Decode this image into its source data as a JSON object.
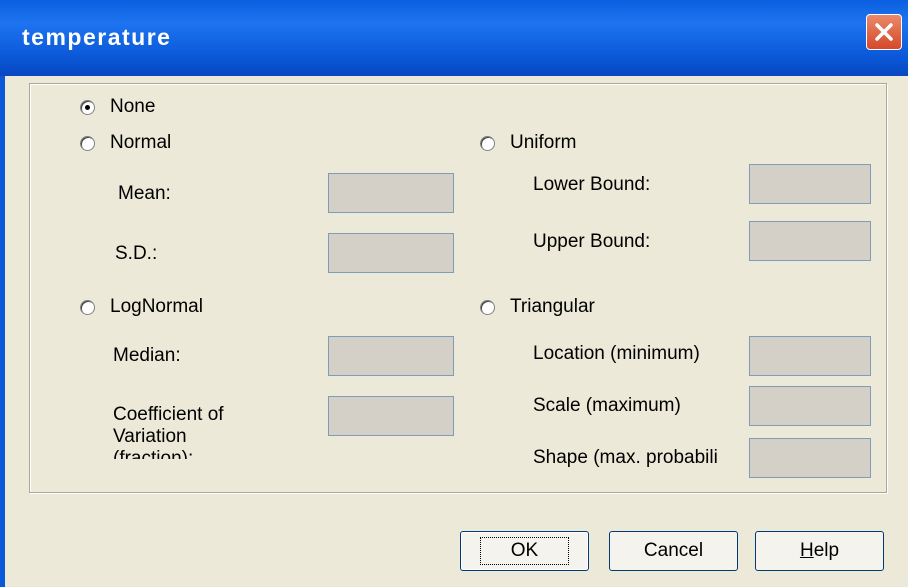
{
  "window": {
    "title": "temperature"
  },
  "options": {
    "none": {
      "label": "None",
      "selected": true
    },
    "normal": {
      "label": "Normal",
      "mean_label": "Mean:",
      "mean_value": "",
      "sd_label": "S.D.:",
      "sd_value": ""
    },
    "lognormal": {
      "label": "LogNormal",
      "median_label": "Median:",
      "median_value": "",
      "cov_label": "Coefficient of Variation (fraction):",
      "cov_value": ""
    },
    "uniform": {
      "label": "Uniform",
      "lower_label": "Lower Bound:",
      "lower_value": "",
      "upper_label": "Upper Bound:",
      "upper_value": ""
    },
    "triangular": {
      "label": "Triangular",
      "location_label": "Location (minimum)",
      "location_value": "",
      "scale_label": "Scale (maximum)",
      "scale_value": "",
      "shape_label": "Shape (max. probabili",
      "shape_value": ""
    }
  },
  "buttons": {
    "ok": "OK",
    "cancel": "Cancel",
    "help_first": "H",
    "help_rest": "elp"
  }
}
